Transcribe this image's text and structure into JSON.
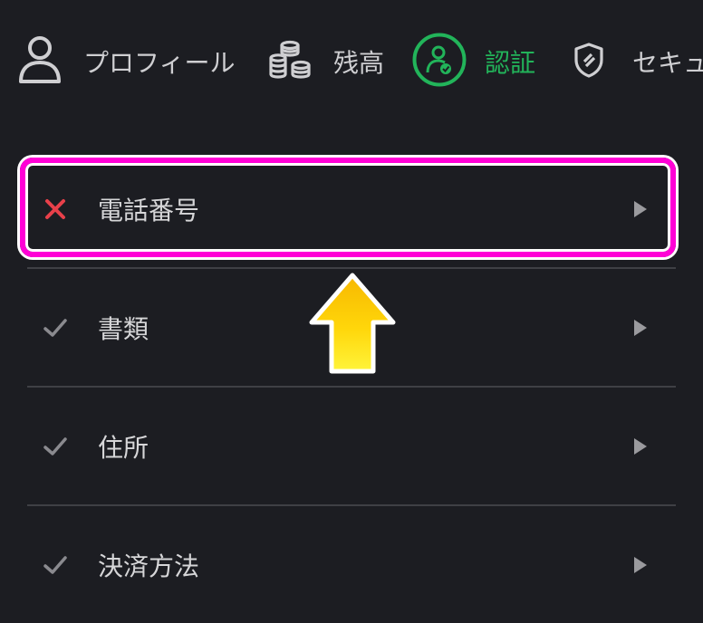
{
  "tabs": [
    {
      "id": "profile",
      "label": "プロフィール",
      "icon": "user-icon",
      "active": false
    },
    {
      "id": "balance",
      "label": "残高",
      "icon": "coins-icon",
      "active": false
    },
    {
      "id": "verification",
      "label": "認証",
      "icon": "user-verified-icon",
      "active": true
    },
    {
      "id": "security",
      "label": "セキュ",
      "icon": "shield-icon",
      "active": false
    }
  ],
  "verification_items": [
    {
      "label": "電話番号",
      "status": "unverified",
      "status_icon": "cross-icon",
      "chevron_icon": "chevron-right-icon"
    },
    {
      "label": "書類",
      "status": "verified",
      "status_icon": "check-icon",
      "chevron_icon": "chevron-right-icon"
    },
    {
      "label": "住所",
      "status": "verified",
      "status_icon": "check-icon",
      "chevron_icon": "chevron-right-icon"
    },
    {
      "label": "決済方法",
      "status": "verified",
      "status_icon": "check-icon",
      "chevron_icon": "chevron-right-icon"
    }
  ],
  "annotation": {
    "highlight_color": "#ff00d6",
    "arrow_color": "#ffd400",
    "arrow_icon": "arrow-up-icon"
  },
  "colors": {
    "background": "#1c1d22",
    "accent": "#22b45a",
    "error": "#e8404a",
    "divider": "#3f4045"
  }
}
